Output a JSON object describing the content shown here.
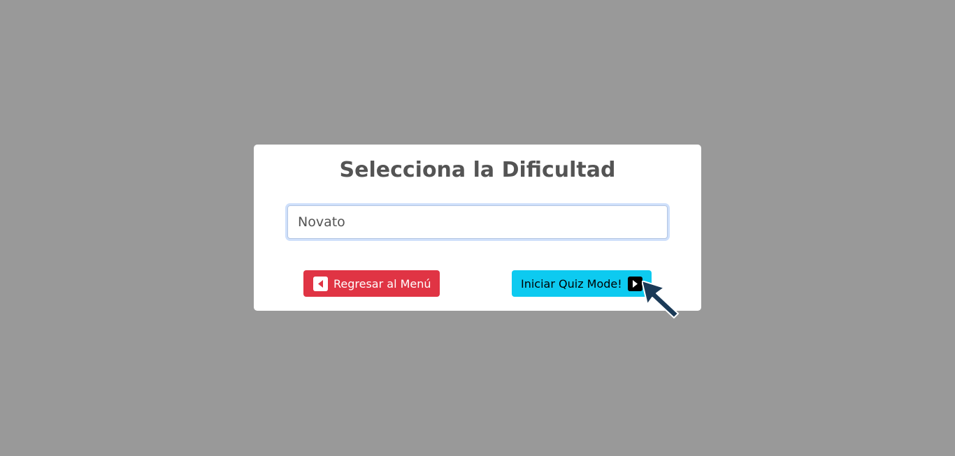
{
  "modal": {
    "title": "Selecciona la Dificultad",
    "difficulty_value": "Novato",
    "back_label": "Regresar al Menú",
    "start_label": "Iniciar Quiz Mode!"
  },
  "icons": {
    "back": "caret-left-square-icon",
    "start": "caret-right-square-icon",
    "cursor": "mouse-pointer-icon"
  },
  "colors": {
    "overlay": "#999999",
    "back_button": "#e03444",
    "start_button": "#0dcaf0",
    "title": "#545454"
  }
}
